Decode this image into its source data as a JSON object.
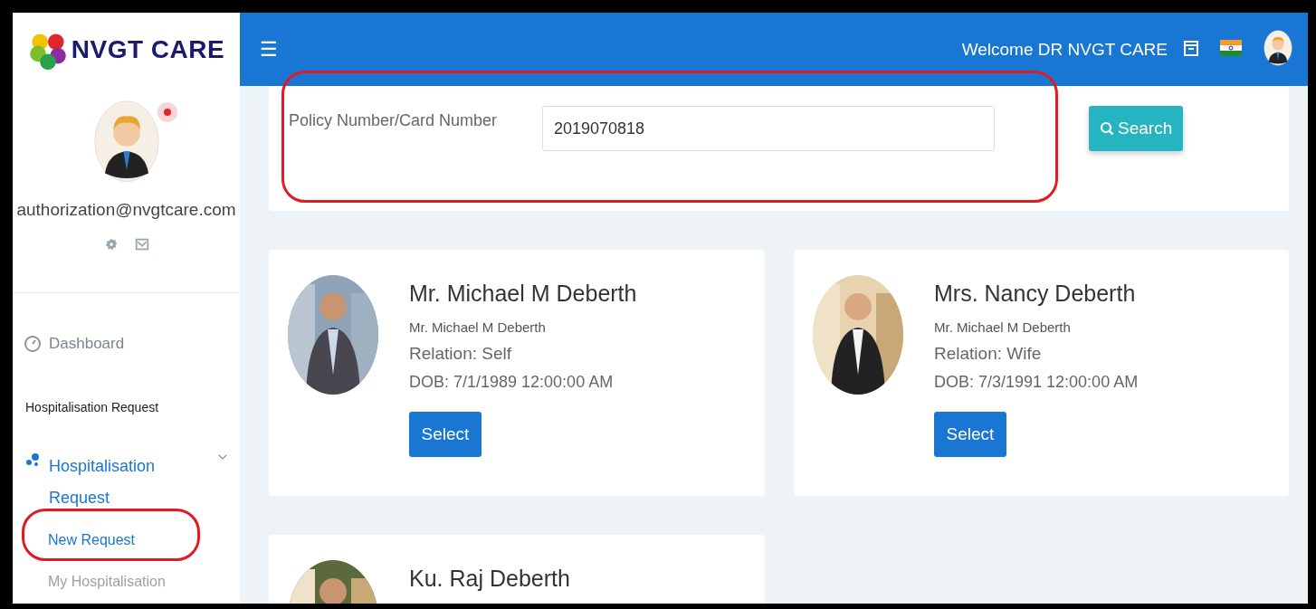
{
  "brand": {
    "name": "NVGT CARE"
  },
  "profile": {
    "email": "authorization@nvgtcare.com",
    "notification": true
  },
  "sidebar": {
    "items": [
      {
        "kind": "link",
        "label": "Dashboard",
        "selected": false
      },
      {
        "kind": "heading",
        "label": "Hospitalisation Request"
      },
      {
        "kind": "group",
        "label": "Hospitalisation Request",
        "expanded": true,
        "children": [
          {
            "label": "New Request",
            "selected": true,
            "circled": true
          },
          {
            "label": "My Hospitalisation",
            "selected": false,
            "circled": false
          }
        ]
      }
    ]
  },
  "topbar": {
    "menu": "☰",
    "welcome": "Welcome DR NVGT CARE"
  },
  "search": {
    "label": "Policy Number/Card Number",
    "value": "2019070818",
    "button": "Search",
    "circled": true
  },
  "members": [
    {
      "name": "Mr. Michael M Deberth",
      "subtitle": "Mr. Michael M Deberth",
      "relation": "Relation: Self",
      "dob": "DOB: 7/1/1989 12:00:00 AM",
      "button": "Select"
    },
    {
      "name": "Mrs. Nancy Deberth",
      "subtitle": "Mr. Michael M Deberth",
      "relation": "Relation: Wife",
      "dob": "DOB: 7/3/1991 12:00:00 AM",
      "button": "Select"
    },
    {
      "name": "Ku. Raj Deberth"
    }
  ]
}
